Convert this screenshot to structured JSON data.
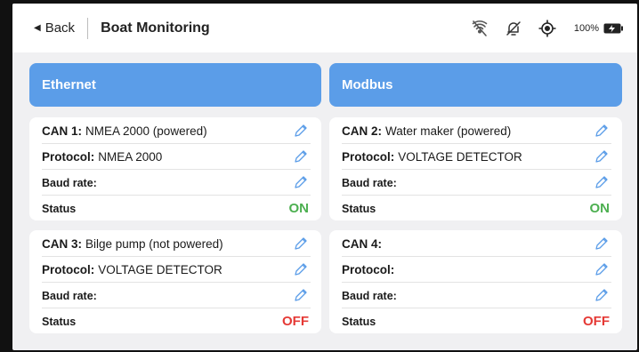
{
  "header": {
    "back_label": "Back",
    "title": "Boat Monitoring",
    "battery_percent": "100%"
  },
  "columns": [
    {
      "title": "Ethernet"
    },
    {
      "title": "Modbus"
    }
  ],
  "cards": [
    {
      "can_label": "CAN 1:",
      "can_value": "NMEA 2000 (powered)",
      "protocol_label": "Protocol:",
      "protocol_value": "NMEA 2000",
      "baud_label": "Baud rate:",
      "status_label": "Status",
      "status": "ON"
    },
    {
      "can_label": "CAN 2:",
      "can_value": "Water maker (powered)",
      "protocol_label": "Protocol:",
      "protocol_value": "VOLTAGE DETECTOR",
      "baud_label": "Baud rate:",
      "status_label": "Status",
      "status": "ON"
    },
    {
      "can_label": "CAN 3:",
      "can_value": "Bilge pump (not powered)",
      "protocol_label": "Protocol:",
      "protocol_value": "VOLTAGE DETECTOR",
      "baud_label": "Baud rate:",
      "status_label": "Status",
      "status": "OFF"
    },
    {
      "can_label": "CAN 4:",
      "can_value": "",
      "protocol_label": "Protocol:",
      "protocol_value": "",
      "baud_label": "Baud rate:",
      "status_label": "Status",
      "status": "OFF"
    }
  ],
  "colors": {
    "accent": "#5b9de8",
    "on": "#4caf50",
    "off": "#e53935"
  }
}
